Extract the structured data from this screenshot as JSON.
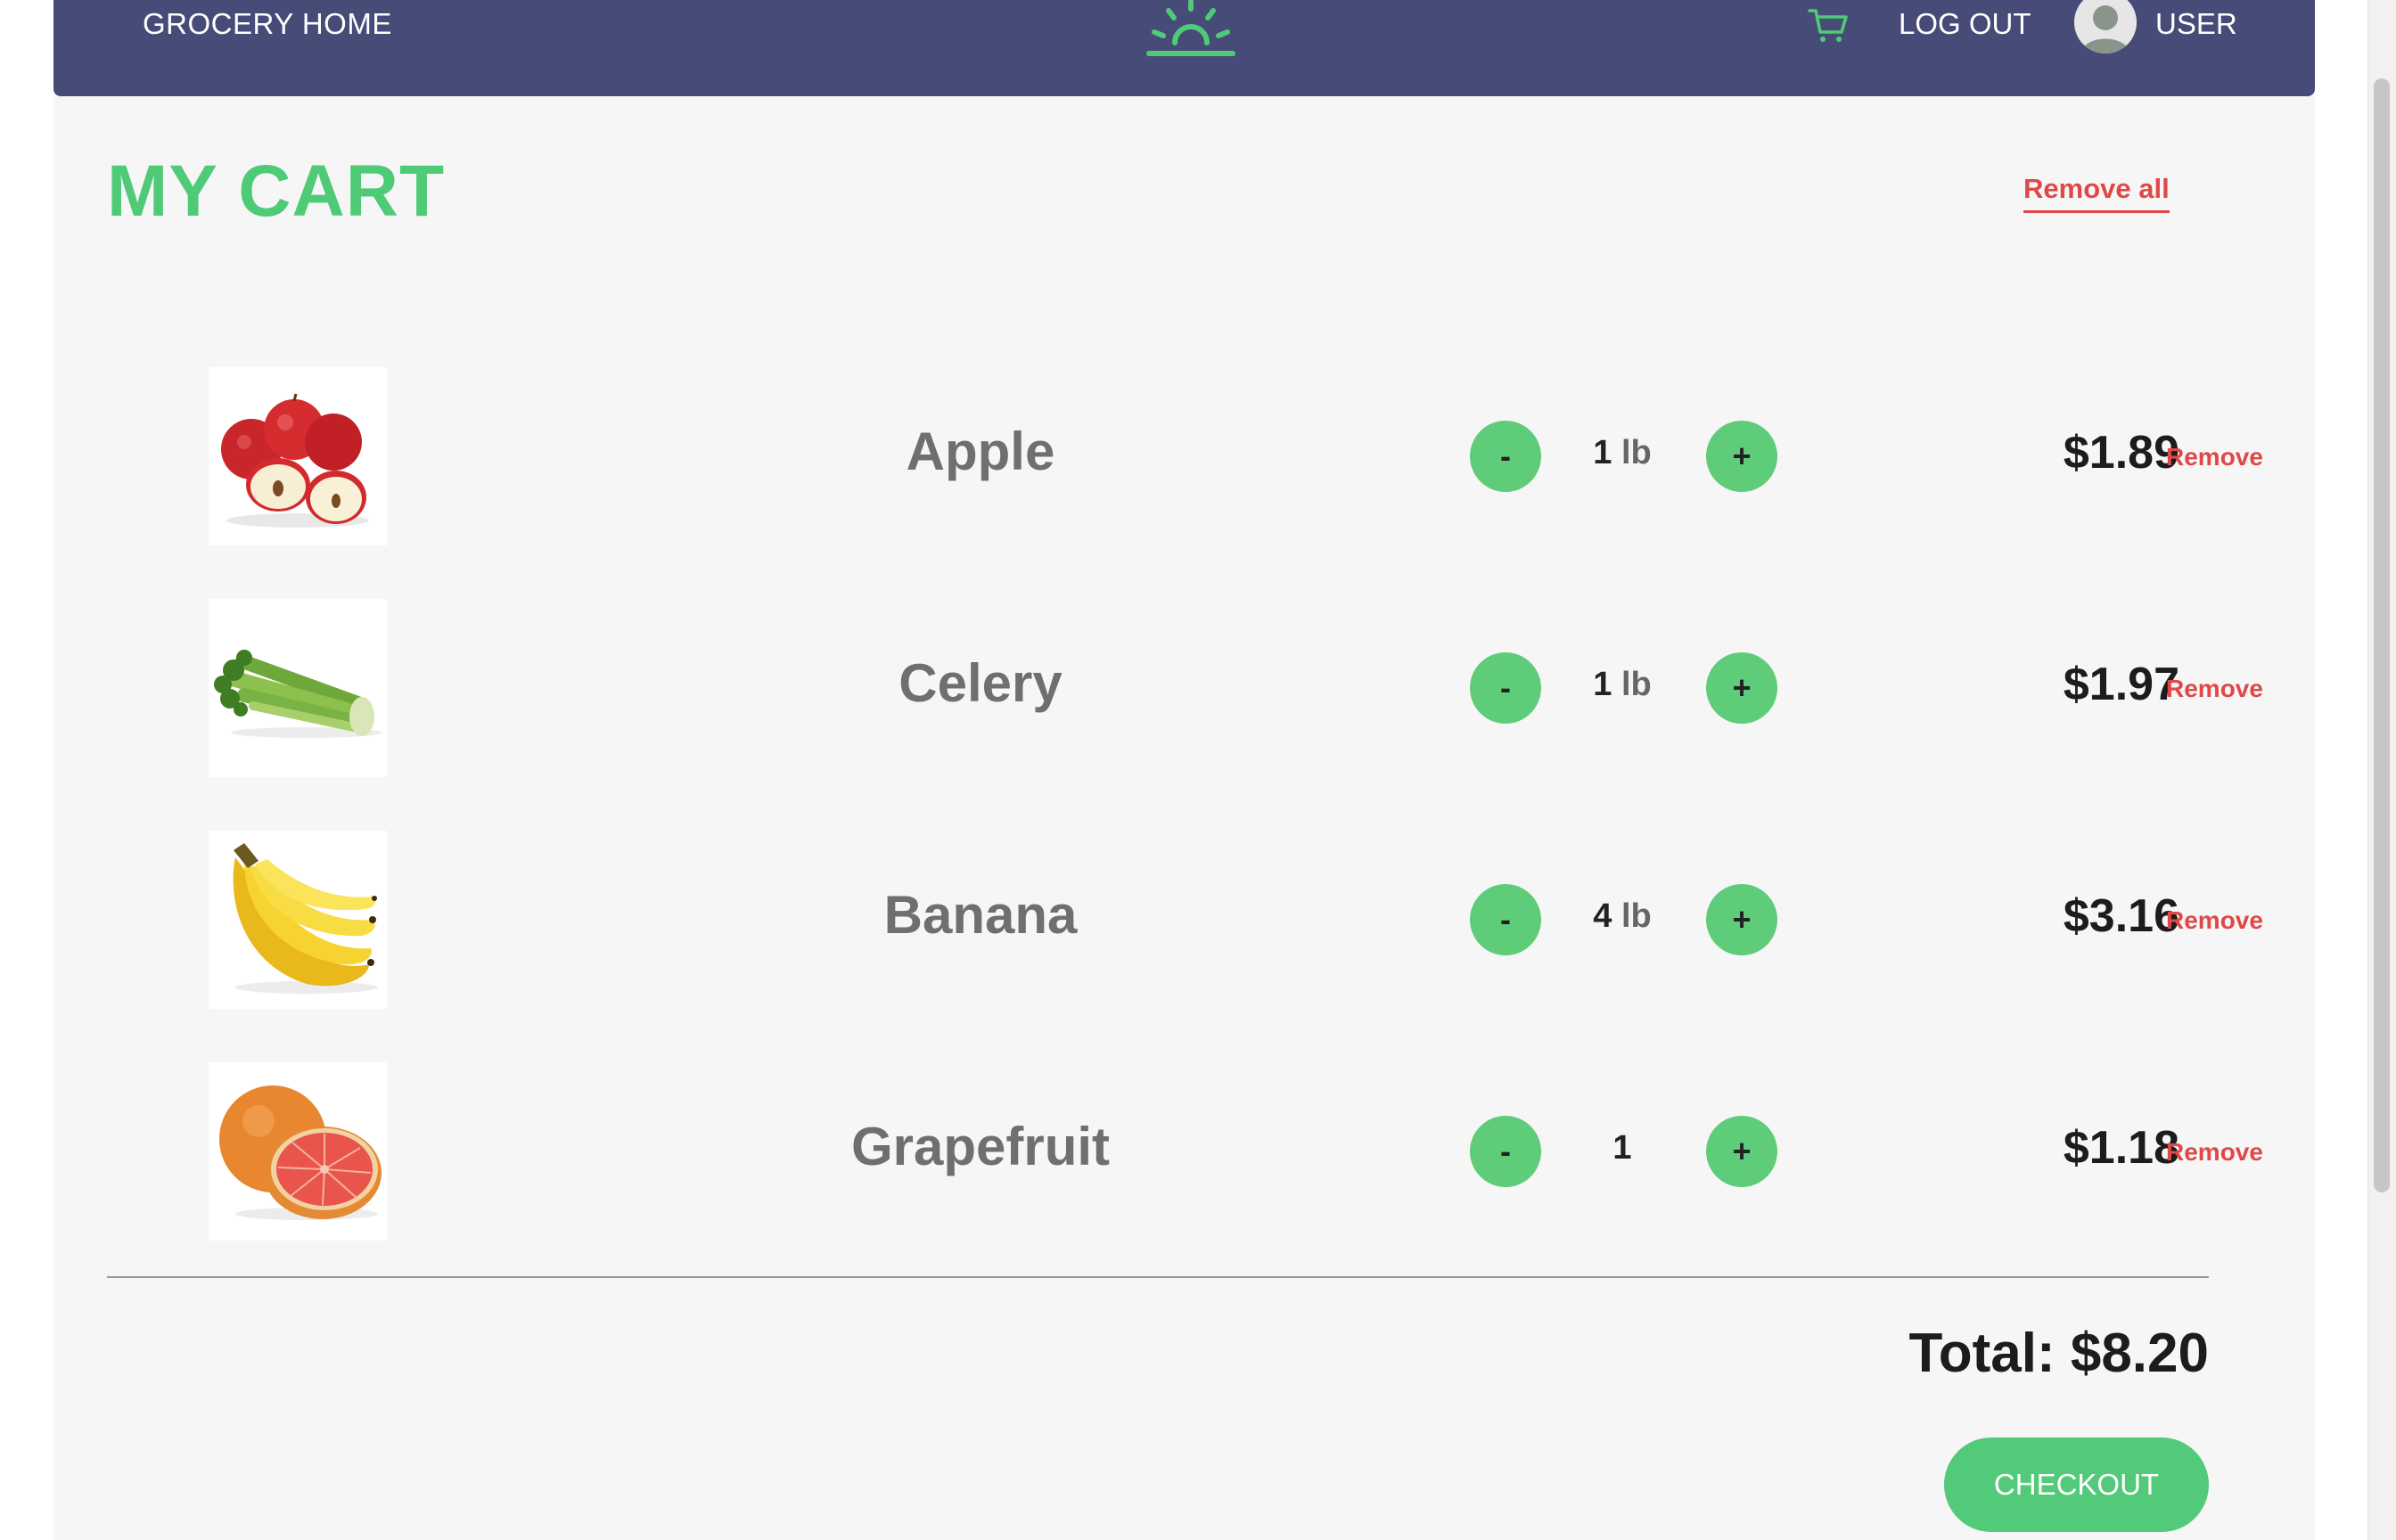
{
  "nav": {
    "home_label": "GROCERY HOME",
    "logo_icon": "sunrise-logo-icon",
    "cart_icon": "shopping-cart-icon",
    "logout_label": "LOG OUT",
    "avatar_icon": "user-avatar-icon",
    "user_label": "USER"
  },
  "cart": {
    "title": "MY CART",
    "remove_all_label": "Remove all",
    "items": [
      {
        "name": "Apple",
        "qty": "1",
        "unit": " lb",
        "minus": "-",
        "plus": "+",
        "price": "$1.89",
        "remove_label": "Remove",
        "image_icon": "apple-image"
      },
      {
        "name": "Celery",
        "qty": "1",
        "unit": " lb",
        "minus": "-",
        "plus": "+",
        "price": "$1.97",
        "remove_label": "Remove",
        "image_icon": "celery-image"
      },
      {
        "name": "Banana",
        "qty": "4",
        "unit": " lb",
        "minus": "-",
        "plus": "+",
        "price": "$3.16",
        "remove_label": "Remove",
        "image_icon": "banana-image"
      },
      {
        "name": "Grapefruit",
        "qty": "1",
        "unit": "",
        "minus": "-",
        "plus": "+",
        "price": "$1.18",
        "remove_label": "Remove",
        "image_icon": "grapefruit-image"
      }
    ],
    "total_label": "Total: $8.20",
    "checkout_label": "CHECKOUT"
  },
  "colors": {
    "nav_bg": "#474b77",
    "accent_green": "#4fca77",
    "remove_red": "#e04848",
    "page_bg": "#f6f6f6"
  }
}
